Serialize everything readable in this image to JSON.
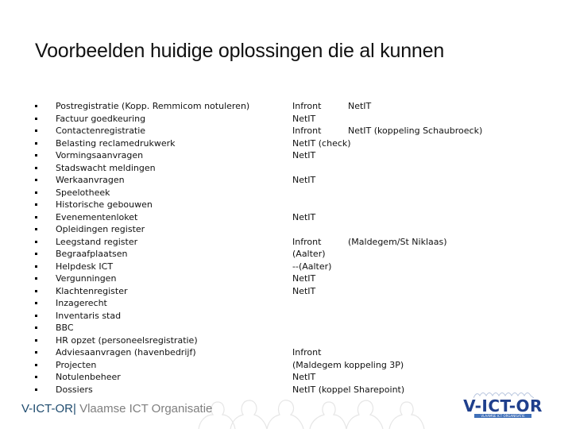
{
  "title": "Voorbeelden huidige oplossingen die al kunnen",
  "items": [
    {
      "label": "Postregistratie (Kopp. Remmicom notuleren)"
    },
    {
      "label": "Factuur goedkeuring"
    },
    {
      "label": "Contactenregistratie"
    },
    {
      "label": "Belasting reclamedrukwerk"
    },
    {
      "label": "Vormingsaanvragen"
    },
    {
      "label": "Stadswacht meldingen"
    },
    {
      "label": "Werkaanvragen"
    },
    {
      "label": "Speelotheek"
    },
    {
      "label": "Historische gebouwen"
    },
    {
      "label": "Evenementenloket"
    },
    {
      "label": "Opleidingen register"
    },
    {
      "label": "Leegstand register"
    },
    {
      "label": "Begraafplaatsen"
    },
    {
      "label": "Helpdesk ICT"
    },
    {
      "label": "Vergunningen"
    },
    {
      "label": "Klachtenregister"
    },
    {
      "label": "Inzagerecht"
    },
    {
      "label": "Inventaris stad"
    },
    {
      "label": "BBC"
    },
    {
      "label": "HR opzet (personeelsregistratie)"
    },
    {
      "label": "Adviesaanvragen (havenbedrijf)"
    },
    {
      "label": "Projecten"
    },
    {
      "label": "Notulenbeheer"
    },
    {
      "label": "Dossiers"
    }
  ],
  "solutions": [
    {
      "row": 0,
      "col1": "Infront",
      "col2": "NetIT"
    },
    {
      "row": 1,
      "col1": "NetIT",
      "col2": ""
    },
    {
      "row": 2,
      "col1": "Infront",
      "col2": "NetIT (koppeling Schaubroeck)"
    },
    {
      "row": 3,
      "col1": "NetIT (check)",
      "col2": ""
    },
    {
      "row": 4,
      "col1": "NetIT",
      "col2": ""
    },
    {
      "row": 6,
      "col1": "NetIT",
      "col2": ""
    },
    {
      "row": 9,
      "col1": "NetIT",
      "col2": ""
    },
    {
      "row": 11,
      "col1": "Infront",
      "col2": "(Maldegem/St Niklaas)"
    },
    {
      "row": 12,
      "col1": "(Aalter)",
      "col2": ""
    },
    {
      "row": 13,
      "col1": "--(Aalter)",
      "col2": ""
    },
    {
      "row": 14,
      "col1": "NetIT",
      "col2": ""
    },
    {
      "row": 15,
      "col1": "NetIT",
      "col2": ""
    },
    {
      "row": 20,
      "col1": "Infront",
      "col2": ""
    },
    {
      "row": 21,
      "col1": "(Maldegem koppeling 3P)",
      "col2": ""
    },
    {
      "row": 22,
      "col1": "NetIT",
      "col2": ""
    },
    {
      "row": 23,
      "col1": "NetIT  (koppel Sharepoint)",
      "col2": ""
    }
  ],
  "footer": {
    "brand": "V-ICT-OR",
    "separator": "|",
    "organisation": " Vlaamse ICT Organisatie"
  },
  "logo": {
    "text": "V-ICT-OR",
    "subtitle": "VLAAMSE ICT ORGANISATIE",
    "color": "#1f3f8c"
  },
  "colors": {
    "brand": "#1e4b6e",
    "footer_gray": "#7f7f7f"
  }
}
